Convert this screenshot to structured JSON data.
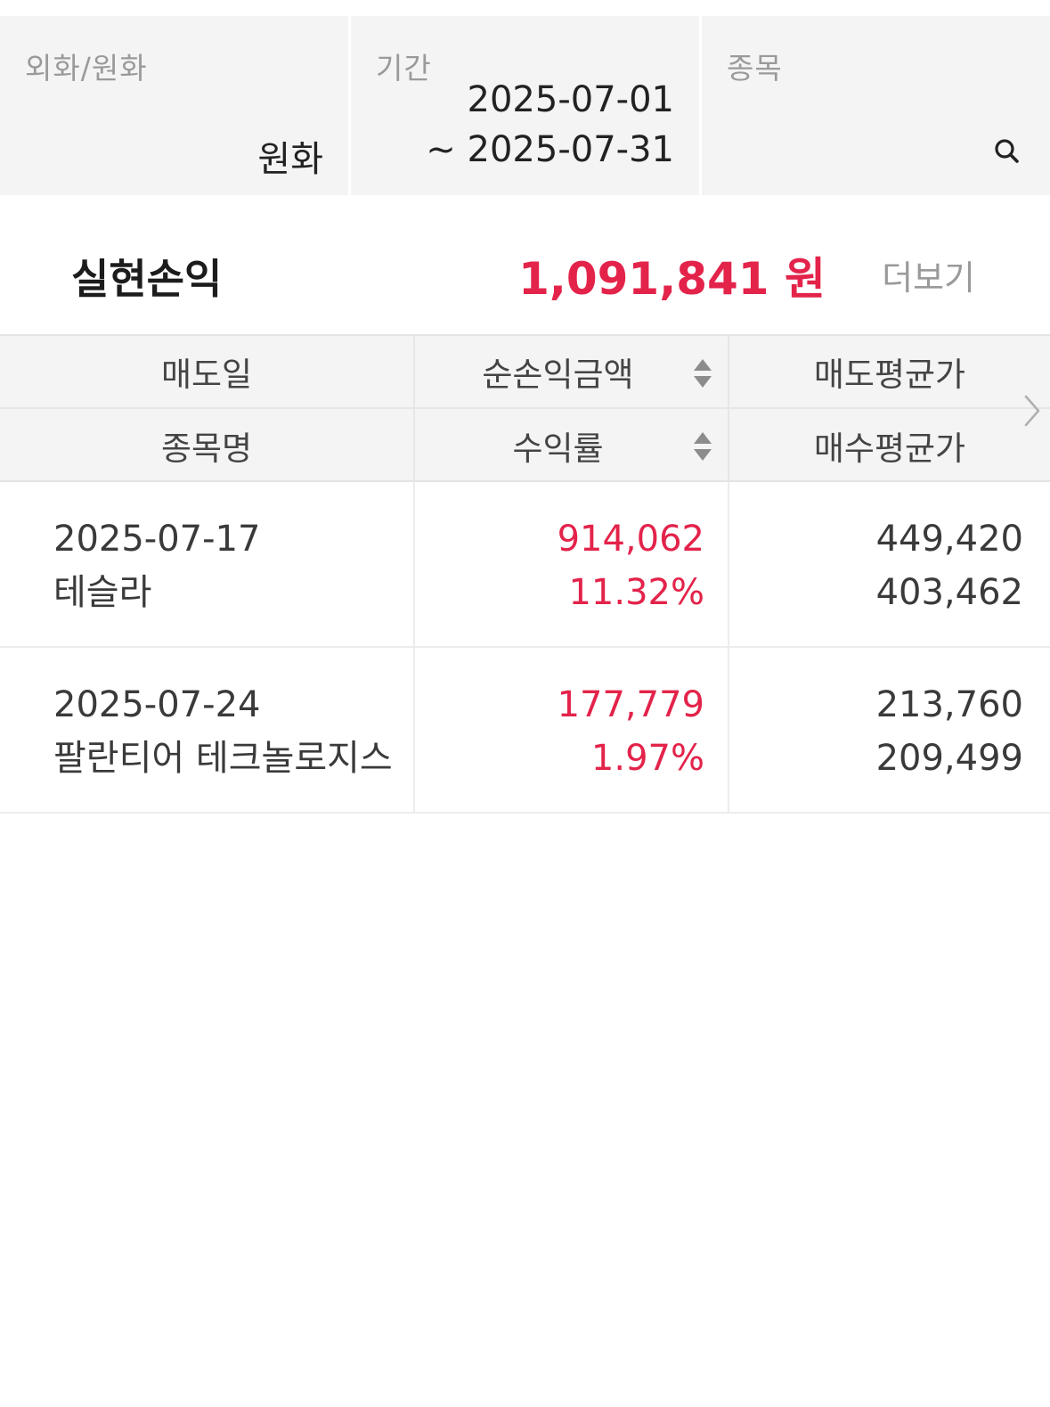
{
  "filters": {
    "currency": {
      "label": "외화/원화",
      "value": "원화"
    },
    "period": {
      "label": "기간",
      "start": "2025-07-01",
      "end": "~ 2025-07-31"
    },
    "stock": {
      "label": "종목",
      "icon": "search-icon"
    }
  },
  "summary": {
    "title": "실현손익",
    "amount": "1,091,841 원",
    "more": "더보기"
  },
  "colors": {
    "profit": "#e3234a",
    "label_gray": "#9a9a9a",
    "header_bg": "#f4f4f4"
  },
  "table": {
    "headers_row1": [
      "매도일",
      "순손익금액",
      "매도평균가"
    ],
    "headers_row2": [
      "종목명",
      "수익률",
      "매수평균가"
    ],
    "rows": [
      {
        "sell_date": "2025-07-17",
        "stock_name": "테슬라",
        "net_profit": "914,062",
        "return_rate": "11.32%",
        "avg_sell_price": "449,420",
        "avg_buy_price": "403,462"
      },
      {
        "sell_date": "2025-07-24",
        "stock_name": "팔란티어 테크놀로지스",
        "net_profit": "177,779",
        "return_rate": "1.97%",
        "avg_sell_price": "213,760",
        "avg_buy_price": "209,499"
      }
    ]
  }
}
